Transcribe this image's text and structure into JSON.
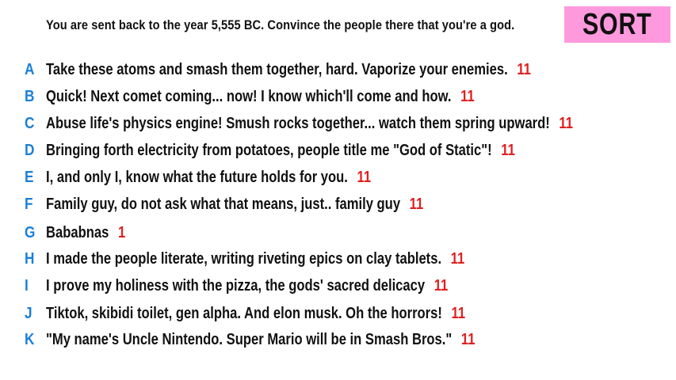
{
  "prompt": "You are sent back to the year 5,555 BC. Convince the people there that you're a god.",
  "sort_label": "SORT",
  "colors": {
    "letter": "#1a7fd8",
    "count": "#e02020",
    "sort_bg": "#ff99dd"
  },
  "answers": [
    {
      "letter": "A",
      "text": "Take these atoms and smash them together, hard. Vaporize your enemies.",
      "count": "11"
    },
    {
      "letter": "B",
      "text": "Quick! Next comet coming... now! I know which'll come and how.",
      "count": "11"
    },
    {
      "letter": "C",
      "text": "Abuse life's physics engine! Smush rocks together... watch them spring upward!",
      "count": "11"
    },
    {
      "letter": "D",
      "text": "Bringing forth electricity from potatoes, people title me \"God of Static\"!",
      "count": "11"
    },
    {
      "letter": "E",
      "text": "I, and only I, know what the future holds for you.",
      "count": "11"
    },
    {
      "letter": "F",
      "text": "Family guy, do not ask what that means, just.. family guy",
      "count": "11"
    },
    {
      "letter": "G",
      "text": "Bababnas",
      "count": "1"
    },
    {
      "letter": "H",
      "text": "I made the people literate, writing riveting epics on clay tablets.",
      "count": "11"
    },
    {
      "letter": "I",
      "text": "I prove my holiness with the pizza, the gods' sacred delicacy",
      "count": "11"
    },
    {
      "letter": "J",
      "text": "Tiktok, skibidi toilet, gen alpha. And elon musk. Oh the horrors!",
      "count": "11"
    },
    {
      "letter": "K",
      "text": "\"My name's Uncle Nintendo. Super Mario will be in Smash Bros.\"",
      "count": "11"
    }
  ]
}
